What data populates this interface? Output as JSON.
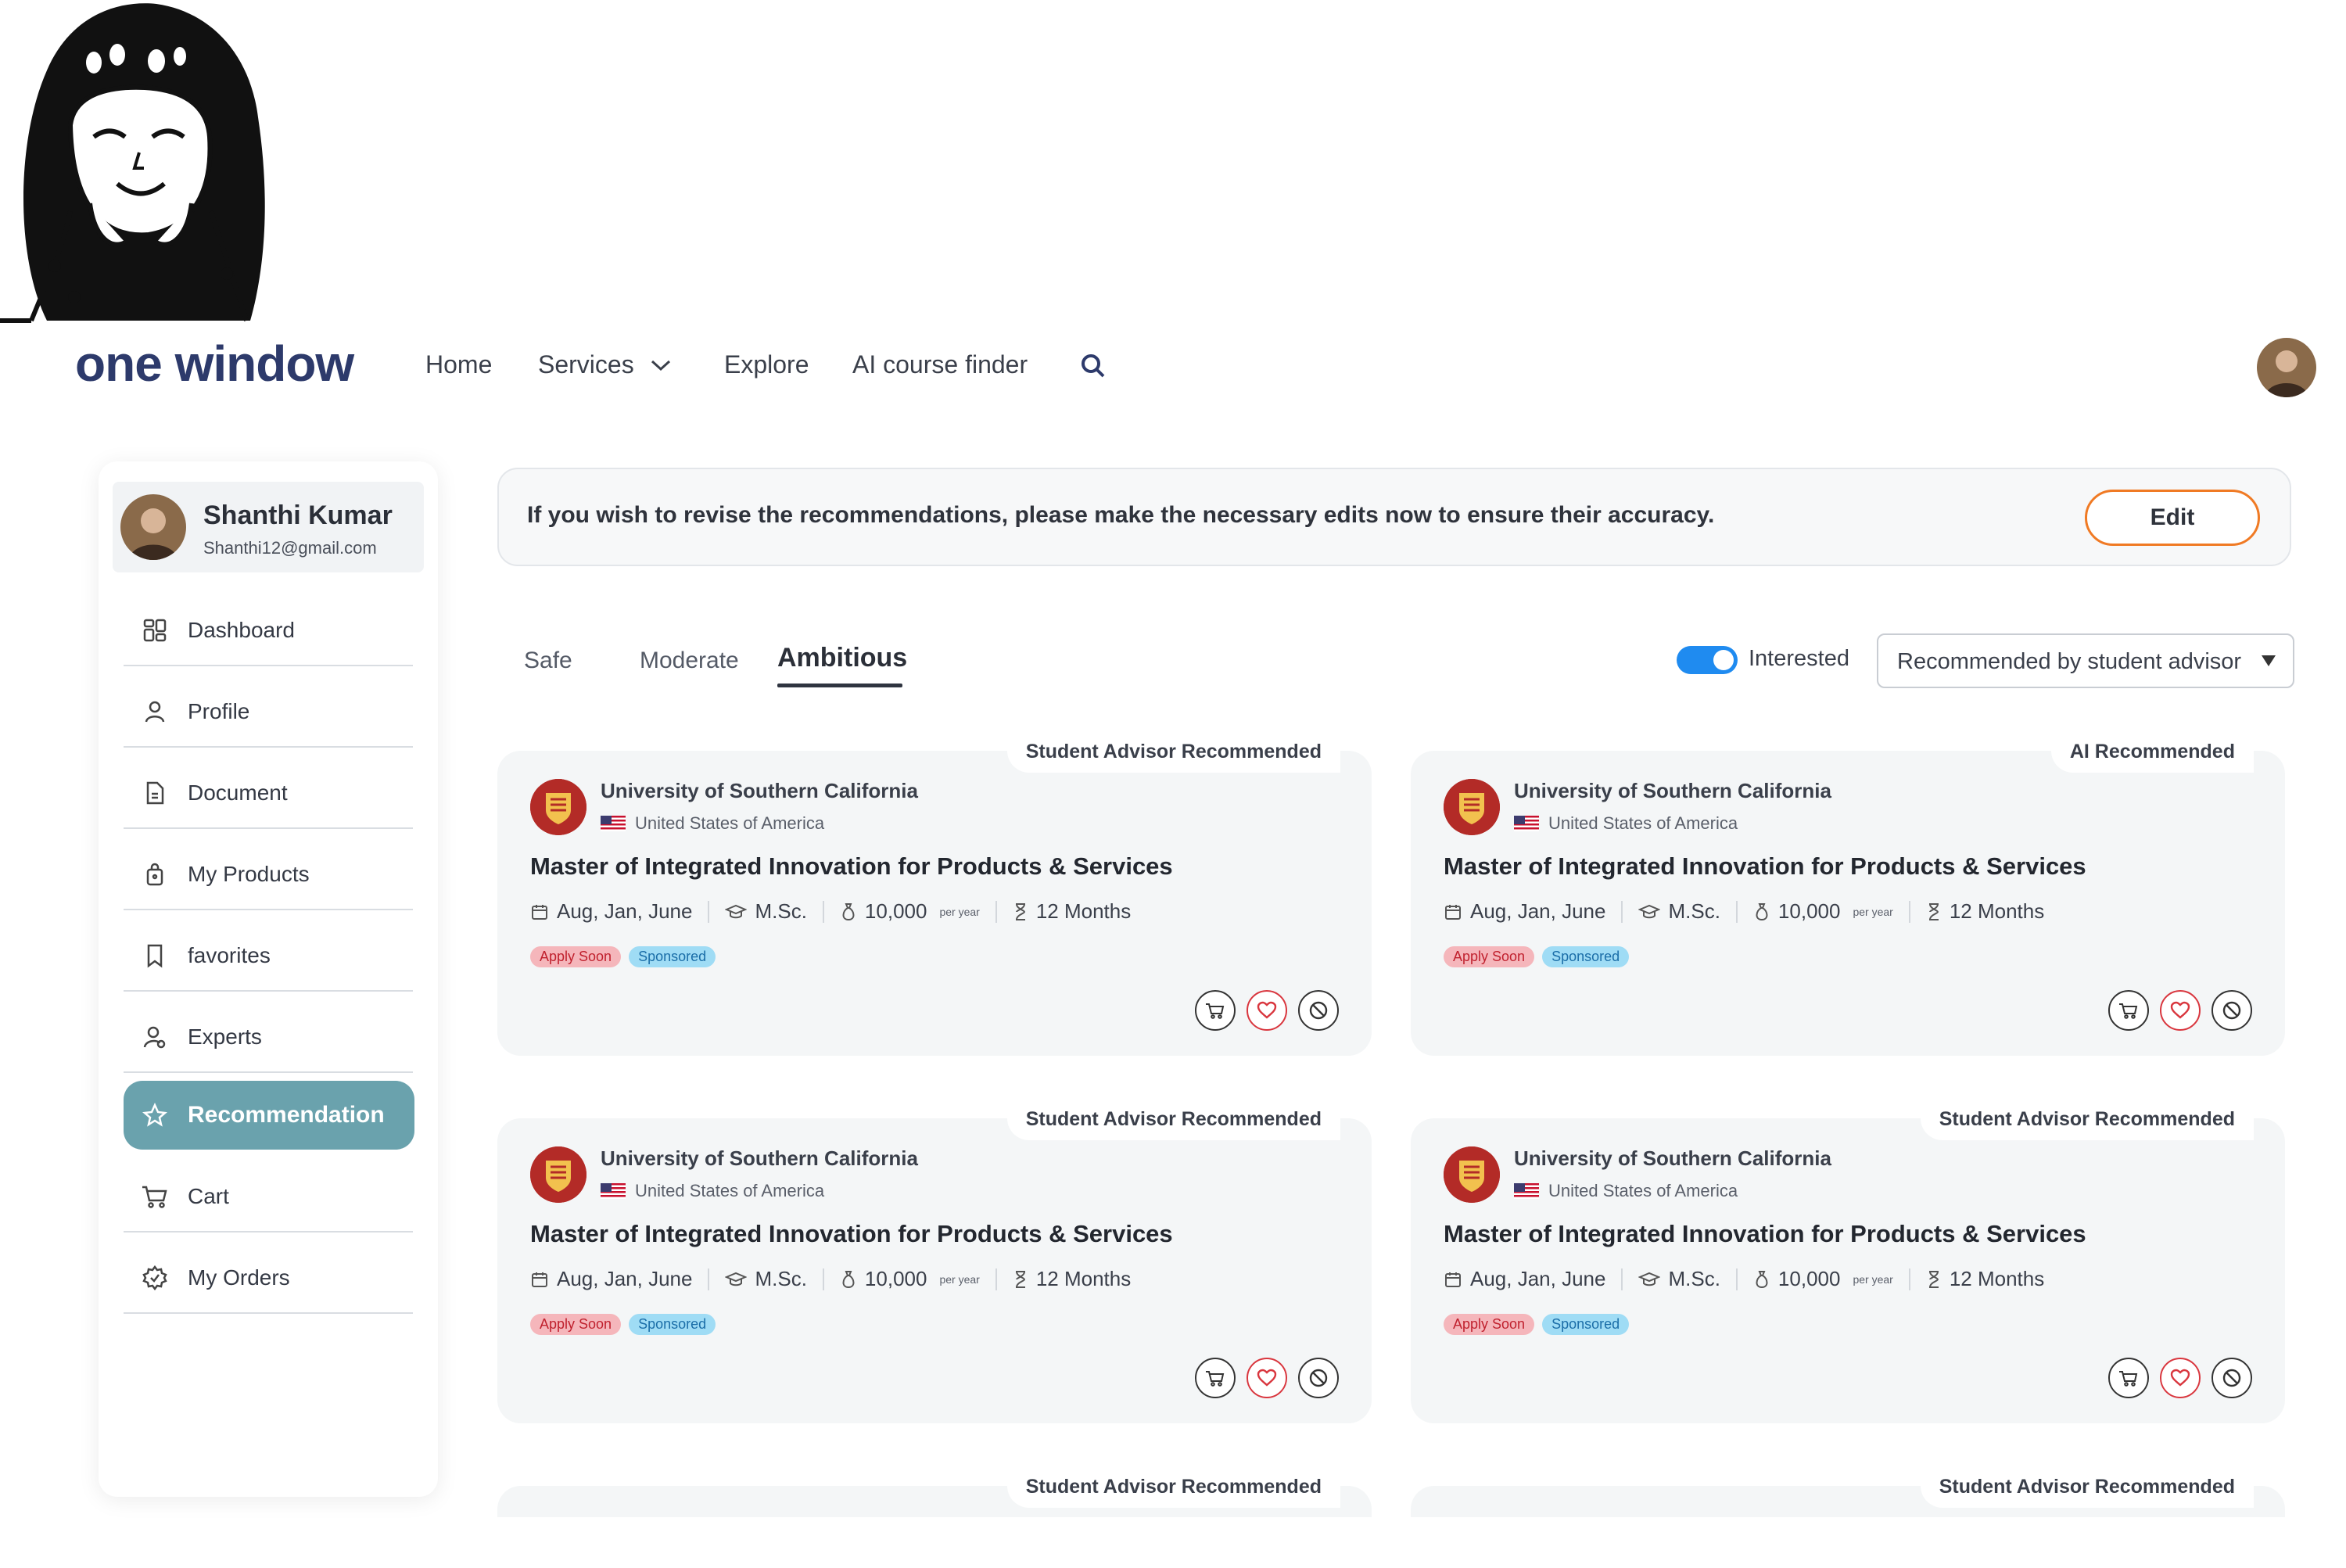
{
  "brand": {
    "name": "one window"
  },
  "nav": {
    "home": "Home",
    "services": "Services",
    "explore": "Explore",
    "ai_course_finder": "AI course finder"
  },
  "user": {
    "name": "Shanthi Kumar",
    "email": "Shanthi12@gmail.com"
  },
  "sidebar": {
    "items": [
      {
        "label": "Dashboard",
        "icon": "dashboard-icon"
      },
      {
        "label": "Profile",
        "icon": "user-icon"
      },
      {
        "label": "Document",
        "icon": "document-icon"
      },
      {
        "label": "My Products",
        "icon": "bag-icon"
      },
      {
        "label": "favorites",
        "icon": "bookmark-icon"
      },
      {
        "label": "Experts",
        "icon": "experts-icon"
      },
      {
        "label": "Recommendation",
        "icon": "star-icon",
        "active": true
      },
      {
        "label": "Cart",
        "icon": "cart-icon"
      },
      {
        "label": "My Orders",
        "icon": "orders-icon"
      }
    ]
  },
  "banner": {
    "text": "If you wish to revise the recommendations, please make the necessary edits now to ensure their accuracy.",
    "edit_label": "Edit"
  },
  "tabs": {
    "safe": "Safe",
    "moderate": "Moderate",
    "ambitious": "Ambitious",
    "active": "Ambitious"
  },
  "filters": {
    "interested_label": "Interested",
    "interested_on": true,
    "sort_value": "Recommended by student advisor"
  },
  "cards": [
    {
      "badge": "Student Advisor Recommended",
      "university": "University of Southern California",
      "country": "United States of America",
      "title": "Master of Integrated Innovation  for Products & Services",
      "intake": "Aug, Jan, June",
      "degree": "M.Sc.",
      "fee": "10,000",
      "fee_unit": "per year",
      "duration": "12 Months",
      "tags": [
        "Apply Soon",
        "Sponsored"
      ]
    },
    {
      "badge": "AI Recommended",
      "university": "University of Southern California",
      "country": "United States of America",
      "title": "Master of Integrated Innovation  for Products & Services",
      "intake": "Aug, Jan, June",
      "degree": "M.Sc.",
      "fee": "10,000",
      "fee_unit": "per year",
      "duration": "12 Months",
      "tags": [
        "Apply Soon",
        "Sponsored"
      ]
    },
    {
      "badge": "Student Advisor Recommended",
      "university": "University of Southern California",
      "country": "United States of America",
      "title": "Master of Integrated Innovation  for Products & Services",
      "intake": "Aug, Jan, June",
      "degree": "M.Sc.",
      "fee": "10,000",
      "fee_unit": "per year",
      "duration": "12 Months",
      "tags": [
        "Apply Soon",
        "Sponsored"
      ]
    },
    {
      "badge": "Student Advisor Recommended",
      "university": "University of Southern California",
      "country": "United States of America",
      "title": "Master of Integrated Innovation  for Products & Services",
      "intake": "Aug, Jan, June",
      "degree": "M.Sc.",
      "fee": "10,000",
      "fee_unit": "per year",
      "duration": "12 Months",
      "tags": [
        "Apply Soon",
        "Sponsored"
      ]
    },
    {
      "badge": "Student Advisor Recommended",
      "partial": true
    },
    {
      "badge": "Student Advisor Recommended",
      "partial": true
    }
  ],
  "colors": {
    "brand": "#2d3a6b",
    "active_sidebar": "#6aa2ad",
    "edit_border": "#f07a24",
    "toggle_on": "#1f8bf0",
    "apply_tag": "#f5b6bb",
    "sponsored_tag": "#9fdcf5"
  }
}
